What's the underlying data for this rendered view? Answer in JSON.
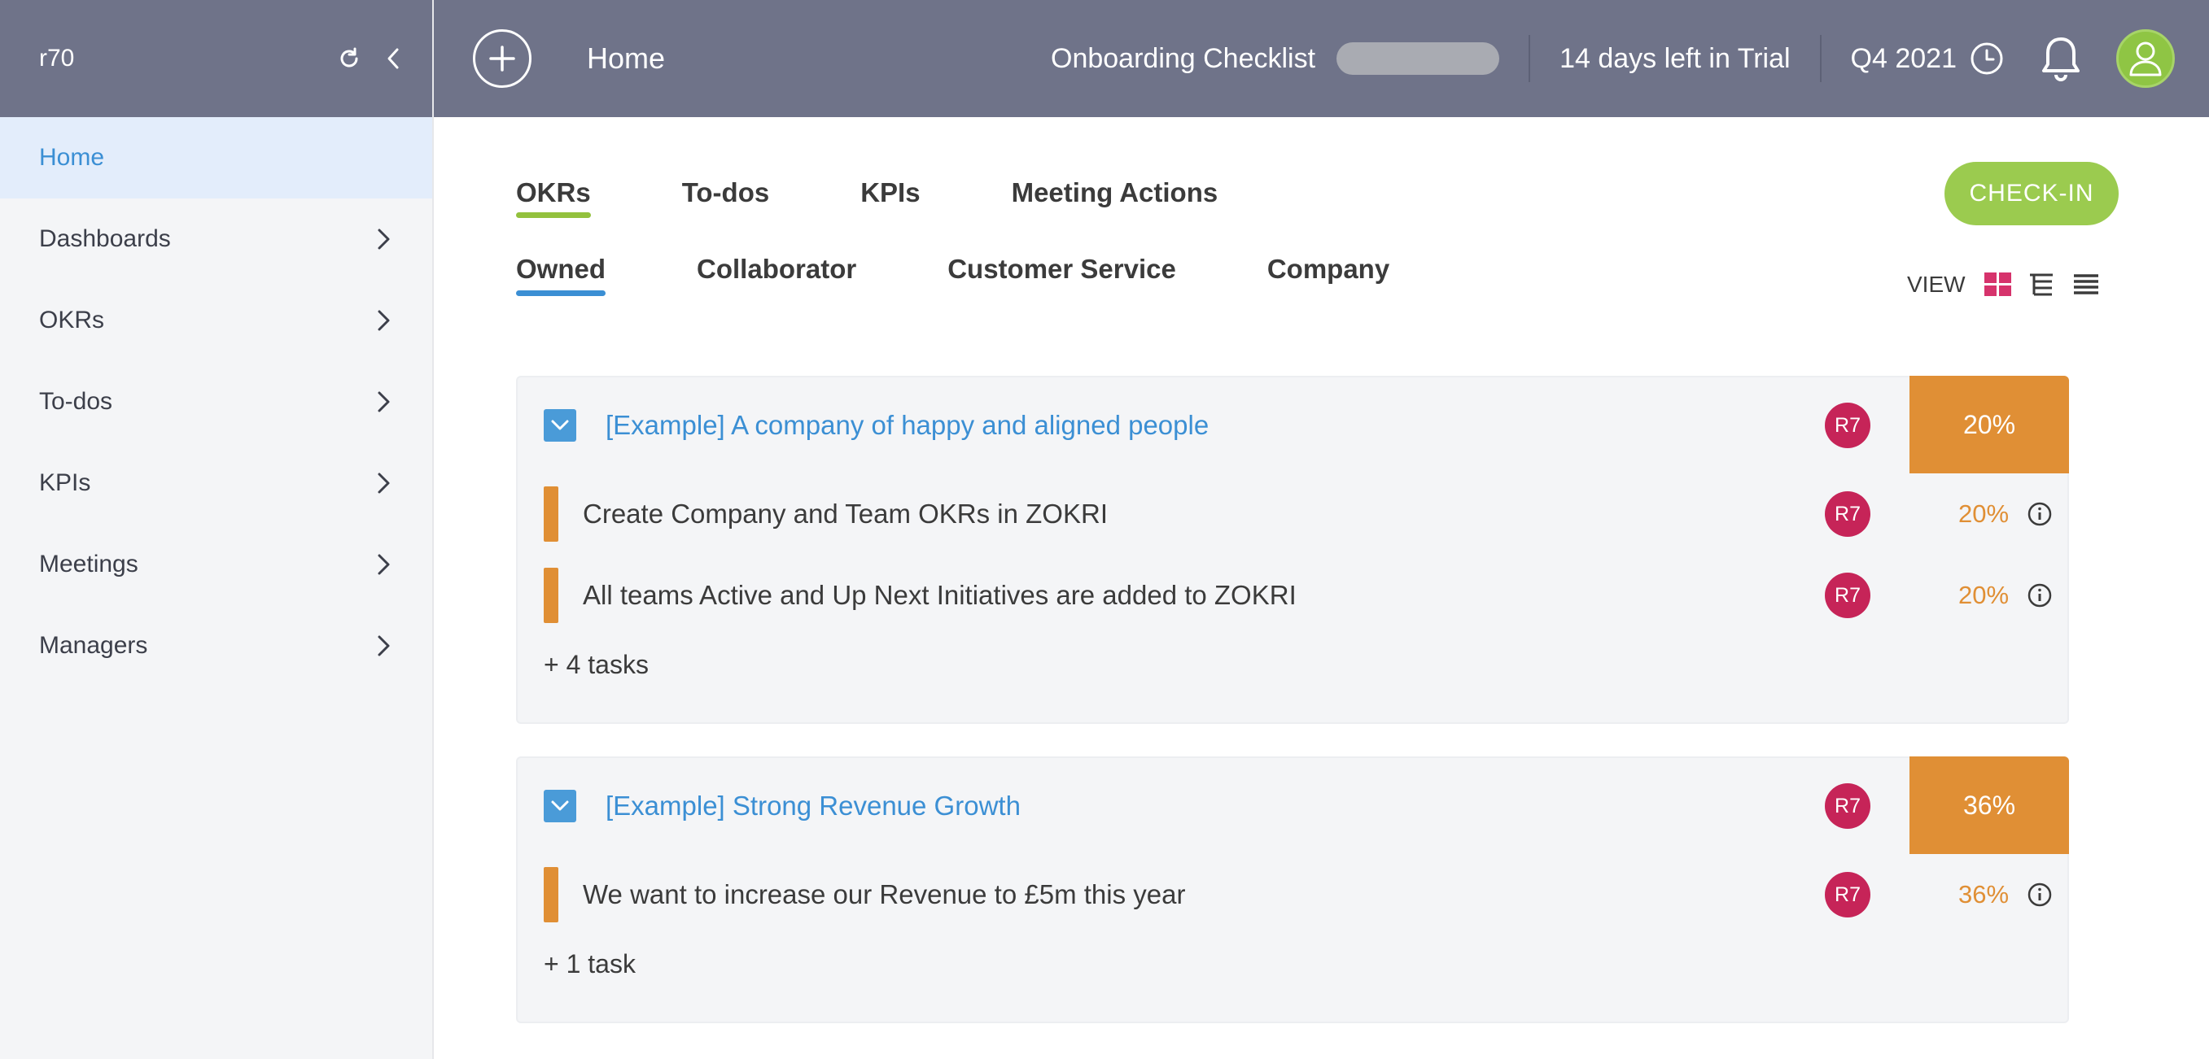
{
  "sidebar": {
    "org_name": "r70",
    "icons": [
      "refresh-icon",
      "chevron-left-icon"
    ],
    "items": [
      {
        "label": "Home",
        "active": true
      },
      {
        "label": "Dashboards"
      },
      {
        "label": "OKRs"
      },
      {
        "label": "To-dos"
      },
      {
        "label": "KPIs"
      },
      {
        "label": "Meetings"
      },
      {
        "label": "Managers"
      }
    ]
  },
  "topbar": {
    "title": "Home",
    "onboarding_label": "Onboarding Checklist",
    "trial_text": "14 days left in Trial",
    "quarter": "Q4 2021",
    "icons": [
      "plus-icon",
      "clock-icon",
      "bell-icon",
      "user-icon"
    ]
  },
  "tabs": {
    "primary": [
      "OKRs",
      "To-dos",
      "KPIs",
      "Meeting Actions"
    ],
    "primary_active": "OKRs",
    "secondary": [
      "Owned",
      "Collaborator",
      "Customer Service",
      "Company"
    ],
    "secondary_active": "Owned"
  },
  "checkin_label": "CHECK-IN",
  "view": {
    "label": "VIEW",
    "icons": [
      "grid-view-icon",
      "tree-view-icon",
      "list-view-icon"
    ]
  },
  "objectives": [
    {
      "title": "[Example] A company of happy and aligned people",
      "owner": "R7",
      "progress": "20%",
      "key_results": [
        {
          "title": "Create Company and Team OKRs in ZOKRI",
          "owner": "R7",
          "progress": "20%"
        },
        {
          "title": "All teams Active and Up Next Initiatives are added to ZOKRI",
          "owner": "R7",
          "progress": "20%"
        }
      ],
      "more_tasks": "+ 4 tasks"
    },
    {
      "title": "[Example] Strong Revenue Growth",
      "owner": "R7",
      "progress": "36%",
      "key_results": [
        {
          "title": "We want to increase our Revenue to £5m this year",
          "owner": "R7",
          "progress": "36%"
        }
      ],
      "more_tasks": "+ 1 task"
    }
  ],
  "colors": {
    "header_bg": "#6f7389",
    "accent_blue": "#3b8fd4",
    "accent_green": "#93c13d",
    "progress_orange": "#e08f35",
    "avatar_red": "#c62458"
  }
}
